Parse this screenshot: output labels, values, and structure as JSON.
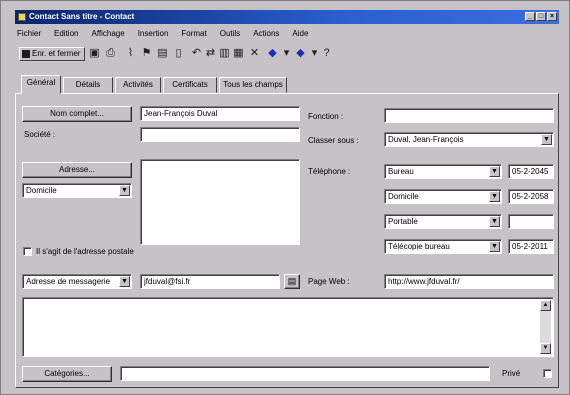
{
  "window": {
    "title": "Contact Sans titre - Contact",
    "controls": [
      "_",
      "□",
      "×"
    ]
  },
  "menu": [
    "Fichier",
    "Edition",
    "Affichage",
    "Insertion",
    "Format",
    "Outils",
    "Actions",
    "Aide"
  ],
  "toolbar": {
    "save_label": "Enr. et fermer",
    "icons": [
      "save-icon",
      "print-icon",
      "attach-icon",
      "flag-icon",
      "categories-icon",
      "properties-icon",
      "delete-icon",
      "previous-icon",
      "next-icon",
      "help-icon"
    ]
  },
  "tabs": [
    "Général",
    "Détails",
    "Activités",
    "Certificats",
    "Tous les champs"
  ],
  "general": {
    "full_name_button": "Nom complet...",
    "full_name_value": "Jean-François Duval",
    "company_label": "Société :",
    "company_value": "",
    "job_label": "Fonction :",
    "job_value": "",
    "file_as_label": "Classer sous :",
    "file_as_value": "Duval, Jean-François",
    "address_button": "Adresse...",
    "address_type": "Domicile",
    "address_value": "",
    "mailing_checkbox_label": "Il s'agit de l'adresse postale",
    "phone_label": "Téléphone :",
    "phones": [
      {
        "type": "Bureau",
        "value": "05-2-2045"
      },
      {
        "type": "Domicile",
        "value": "05-2-2058"
      },
      {
        "type": "Portable",
        "value": ""
      },
      {
        "type": "Télécopie bureau",
        "value": "05-2-2011"
      }
    ],
    "email_type": "Adresse de messagerie",
    "email_value": "jfduval@fsi.fr",
    "webpage_label": "Page Web :",
    "webpage_value": "http://www.jfduval.fr/",
    "notes_value": "",
    "categories_button": "Catégories...",
    "categories_value": "",
    "private_label": "Privé"
  },
  "icons": {
    "dropdown": "chevron-down-icon",
    "addressbook": "address-book-icon"
  }
}
